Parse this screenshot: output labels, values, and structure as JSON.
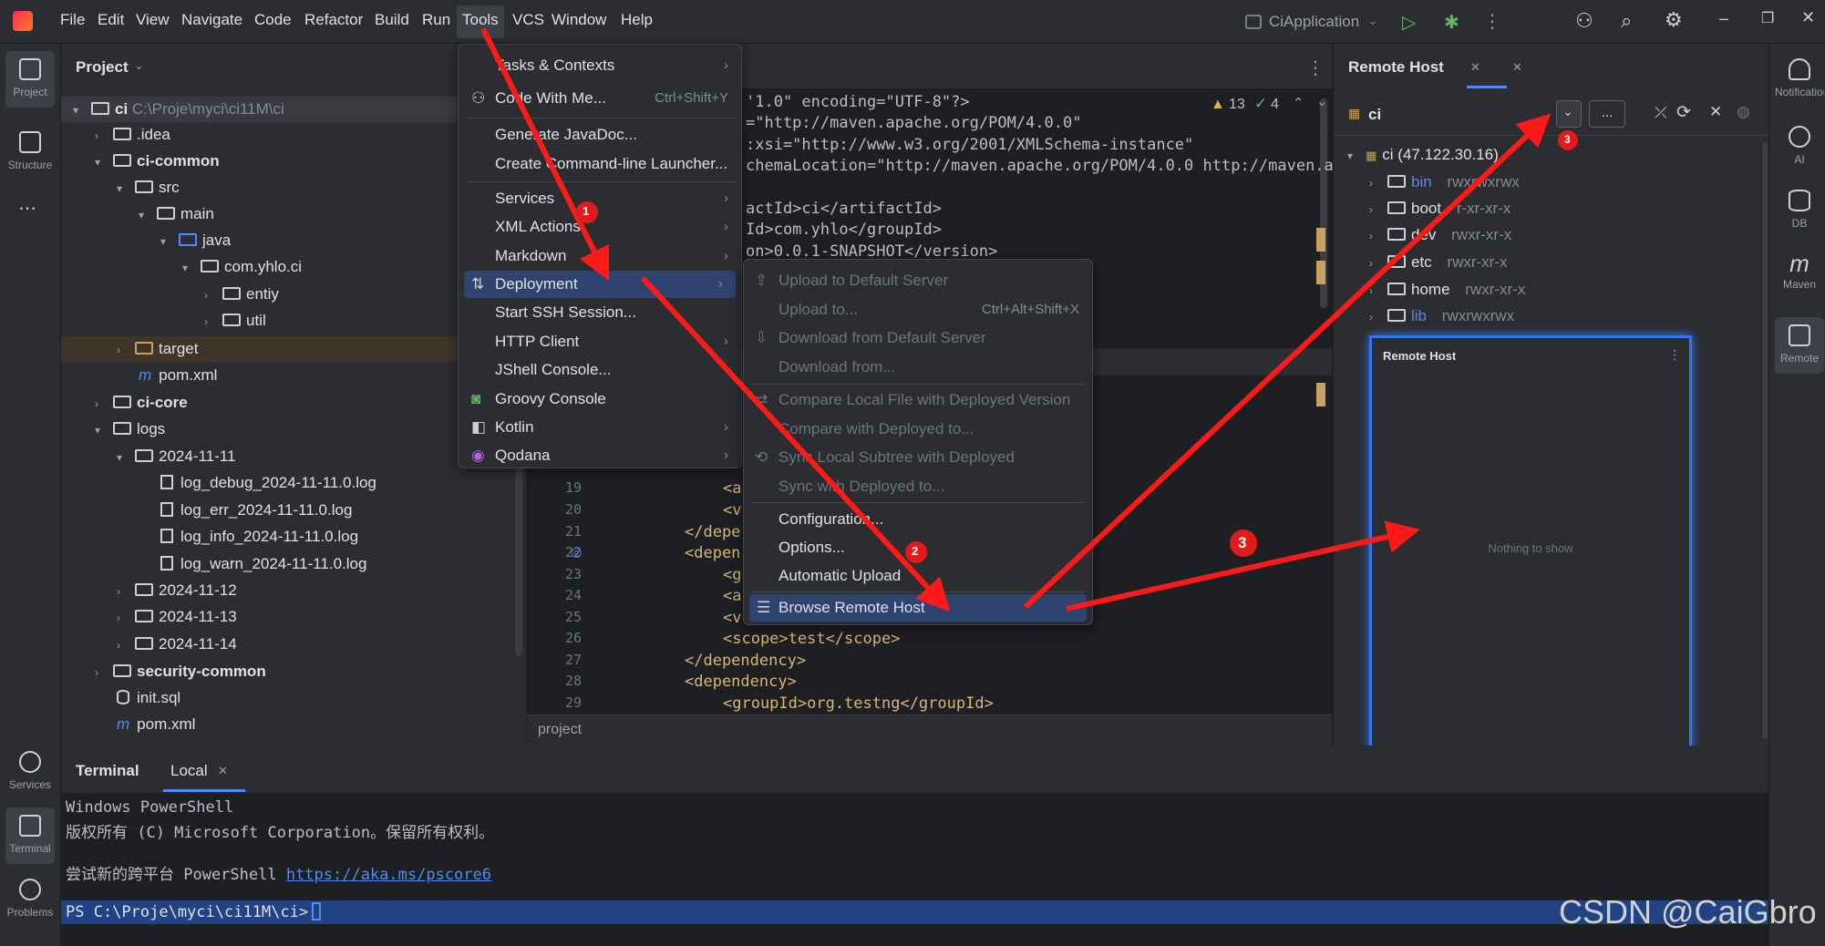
{
  "menubar": {
    "items": [
      "File",
      "Edit",
      "View",
      "Navigate",
      "Code",
      "Refactor",
      "Build",
      "Run",
      "Tools",
      "VCS",
      "Window",
      "Help"
    ],
    "run_config": "CiApplication"
  },
  "left_strip": {
    "project": "Project",
    "structure": "Structure",
    "services": "Services",
    "terminal": "Terminal",
    "problems": "Problems"
  },
  "project_panel": {
    "title": "Project",
    "rows": [
      {
        "name": "ci",
        "extra": "C:\\Proje\\myci\\ci11M\\ci"
      },
      {
        "name": ".idea"
      },
      {
        "name": "ci-common"
      },
      {
        "name": "src"
      },
      {
        "name": "main"
      },
      {
        "name": "java"
      },
      {
        "name": "com.yhlo.ci"
      },
      {
        "name": "entiy"
      },
      {
        "name": "util"
      },
      {
        "name": "target"
      },
      {
        "name": "pom.xml"
      },
      {
        "name": "ci-core"
      },
      {
        "name": "logs"
      },
      {
        "name": "2024-11-11"
      },
      {
        "name": "log_debug_2024-11-11.0.log"
      },
      {
        "name": "log_err_2024-11-11.0.log"
      },
      {
        "name": "log_info_2024-11-11.0.log"
      },
      {
        "name": "log_warn_2024-11-11.0.log"
      },
      {
        "name": "2024-11-12"
      },
      {
        "name": "2024-11-13"
      },
      {
        "name": "2024-11-14"
      },
      {
        "name": "security-common"
      },
      {
        "name": "init.sql"
      },
      {
        "name": "pom.xml"
      }
    ]
  },
  "editor": {
    "warnings": "13",
    "checks": "4",
    "lines_top": [
      "'1.0\" encoding=\"UTF-8\"?>",
      "=\"http://maven.apache.org/POM/4.0.0\"",
      ":xsi=\"http://www.w3.org/2001/XMLSchema-instance\"",
      "chemaLocation=\"http://maven.apache.org/POM/4.0.0 http://maven.ap",
      "",
      "actId>ci</artifactId>",
      "Id>com.yhlo</groupId>",
      "on>0.0.1-SNAPSHOT</version>"
    ],
    "gutter": [
      "19",
      "20",
      "21",
      "22",
      "23",
      "24",
      "25",
      "26",
      "27",
      "28",
      "29"
    ],
    "lines_bottom": [
      "<a",
      "<v",
      "</depe",
      "<depen",
      "<g",
      "<a",
      "<v",
      "<scope>test</scope>",
      "</dependency>",
      "<dependency>",
      "<groupId>org.testng</groupId>"
    ],
    "breadcrumb": "project"
  },
  "tools_menu": [
    {
      "label": "Tasks & Contexts",
      "sub": true
    },
    {
      "label": "Code With Me...",
      "shortcut": "Ctrl+Shift+Y"
    },
    {
      "label": "Generate JavaDoc..."
    },
    {
      "label": "Create Command-line Launcher..."
    },
    {
      "label": "Services",
      "sub": true
    },
    {
      "label": "XML Actions",
      "sub": true
    },
    {
      "label": "Markdown",
      "sub": true
    },
    {
      "label": "Deployment",
      "sub": true
    },
    {
      "label": "Start SSH Session..."
    },
    {
      "label": "HTTP Client",
      "sub": true
    },
    {
      "label": "JShell Console..."
    },
    {
      "label": "Groovy Console"
    },
    {
      "label": "Kotlin",
      "sub": true
    },
    {
      "label": "Qodana",
      "sub": true
    }
  ],
  "deployment_menu": [
    {
      "label": "Upload to Default Server",
      "disabled": true
    },
    {
      "label": "Upload to...",
      "shortcut": "Ctrl+Alt+Shift+X",
      "disabled": true
    },
    {
      "label": "Download from Default Server",
      "disabled": true
    },
    {
      "label": "Download from...",
      "disabled": true
    },
    {
      "label": "Compare Local File with Deployed Version",
      "disabled": true
    },
    {
      "label": "Compare with Deployed to...",
      "disabled": true
    },
    {
      "label": "Sync Local Subtree with Deployed",
      "disabled": true
    },
    {
      "label": "Sync with Deployed to...",
      "disabled": true
    },
    {
      "label": "Configuration..."
    },
    {
      "label": "Options..."
    },
    {
      "label": "Automatic Upload"
    },
    {
      "label": "Browse Remote Host"
    }
  ],
  "remote_host": {
    "title": "Remote Host",
    "server": "ci",
    "root": "ci (47.122.30.16)",
    "entries": [
      {
        "name": "bin",
        "perm": "rwxrwxrwx"
      },
      {
        "name": "boot",
        "perm": "r-xr-xr-x"
      },
      {
        "name": "dev",
        "perm": "rwxr-xr-x"
      },
      {
        "name": "etc",
        "perm": "rwxr-xr-x"
      },
      {
        "name": "home",
        "perm": "rwxr-xr-x"
      },
      {
        "name": "lib",
        "perm": "rwxrwxrwx"
      }
    ],
    "inner_title": "Remote Host",
    "empty": "Nothing to show",
    "more": "..."
  },
  "right_strip": {
    "notifications": "Notifications",
    "ai": "AI",
    "db": "DB",
    "maven": "Maven",
    "remote": "Remote"
  },
  "terminal": {
    "title": "Terminal",
    "tab": "Local",
    "lines": [
      "Windows PowerShell",
      "版权所有 (C) Microsoft Corporation。保留所有权利。",
      "",
      "尝试新的跨平台 PowerShell "
    ],
    "link": "https://aka.ms/pscore6",
    "prompt": "PS C:\\Proje\\myci\\ci11M\\ci>"
  },
  "annotations": {
    "b1": "1",
    "b2": "2",
    "b3a": "3",
    "b3b": "3"
  },
  "watermark": "CSDN @CaiGbro",
  "colors": {
    "accent": "#2e436e",
    "arrow": "#ff1a1a",
    "link": "#548af7",
    "panel": "#2b2d30",
    "editor": "#1e1f22"
  }
}
